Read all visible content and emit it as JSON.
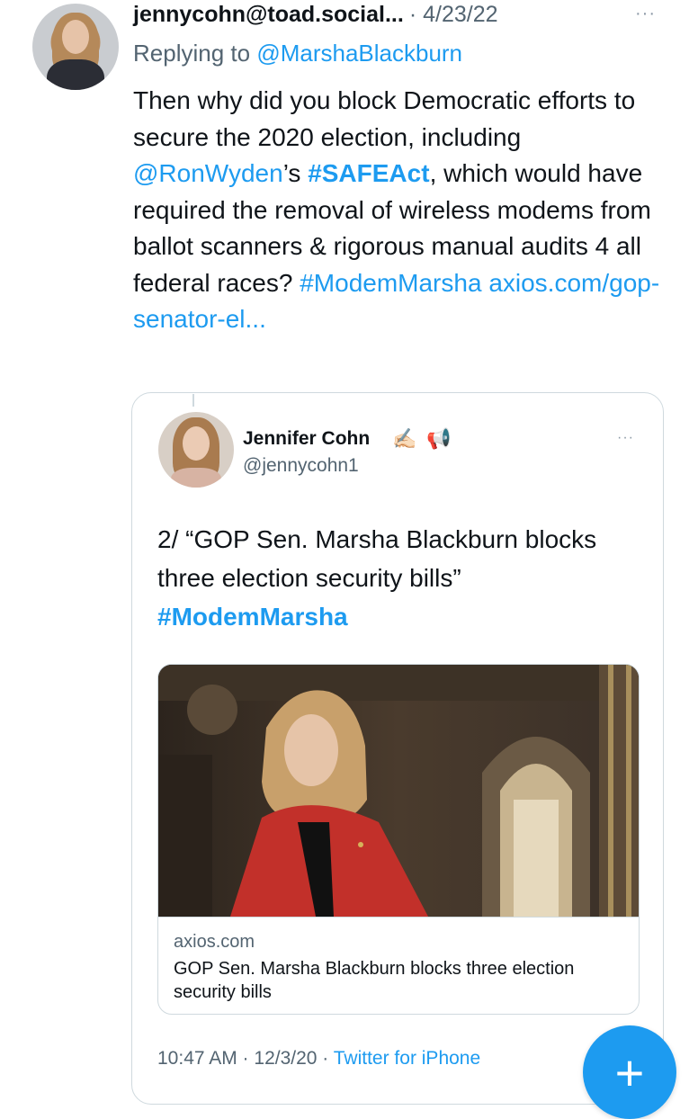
{
  "tweet": {
    "handle": "jennycohn@toad.social...",
    "date": "· 4/23/22",
    "more_icon": "···",
    "reply_prefix": "Replying to ",
    "reply_mention": "@MarshaBlackburn",
    "text_1": "Then why did you block Democratic efforts to secure the 2020 election, including ",
    "mention_ron": "@RonWyden",
    "text_2": "’s ",
    "tag_safe": "#SAFEAct",
    "text_3": ", which would have required the removal of wireless modems from ballot scanners & rigorous manual audits 4 all federal races? ",
    "tag_modem": "#ModemMarsha",
    "text_4": " ",
    "link": "axios.com/gop-senator-el..."
  },
  "quote": {
    "name": "Jennifer Cohn",
    "emoji_1": "✍🏻",
    "emoji_2": "📢",
    "handle": "@jennycohn1",
    "more_icon": "···",
    "text": "2/ “GOP Sen. Marsha Blackburn blocks three election security bills”",
    "tag": "#ModemMarsha",
    "card": {
      "domain": "axios.com",
      "title": "GOP Sen. Marsha Blackburn blocks three election security bills"
    },
    "footer_time": "10:47 AM · 12/3/20 · ",
    "footer_source": "Twitter for iPhone"
  },
  "fab": {
    "icon": "+"
  },
  "colors": {
    "accent": "#1d9bf0",
    "text": "#0f1419",
    "secondary": "#536471",
    "border": "#cfd9de"
  }
}
